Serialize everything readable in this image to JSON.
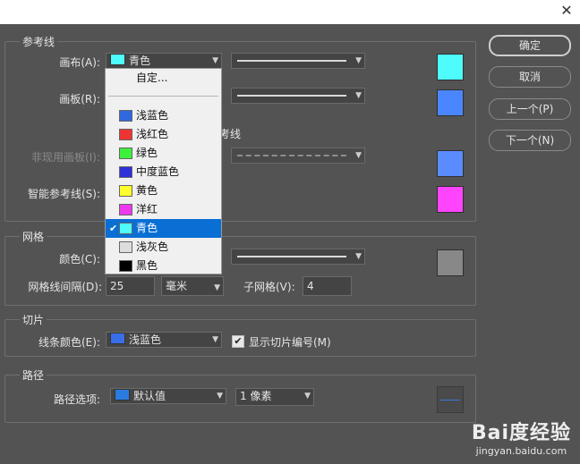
{
  "titlebar": {
    "close_glyph": "✕"
  },
  "guides": {
    "title": "参考线",
    "canvas_label": "画布(A):",
    "canvas_value": "青色",
    "canvas_color": "#4efcfc",
    "artboard_label": "画板(R):",
    "artboard_color": "#4a86ff",
    "partial_checkbox_text": "考线",
    "inactive_label": "非现用画板(I):",
    "inactive_color": "#5a8cff",
    "smart_label": "智能参考线(S):",
    "smart_color": "#ff44ff"
  },
  "grid": {
    "title": "网格",
    "color_label": "颜色(C):",
    "color_swatch": "#888888",
    "spacing_label": "网格线间隔(D):",
    "spacing_value": "25",
    "unit_value": "毫米",
    "subdivisions_label": "子网格(V):",
    "subdivisions_value": "4"
  },
  "slices": {
    "title": "切片",
    "line_color_label": "线条颜色(E):",
    "line_color_value": "浅蓝色",
    "line_color_swatch": "#3a6ee8",
    "show_numbers_label": "显示切片编号(M)",
    "show_numbers_checked": true,
    "check_glyph": "✔"
  },
  "path": {
    "title": "路径",
    "options_label": "路径选项:",
    "options_value": "默认值",
    "options_swatch": "#2a7be0",
    "width_value": "1 像素"
  },
  "buttons": {
    "ok": "确定",
    "cancel": "取消",
    "prev": "上一个(P)",
    "next": "下一个(N)"
  },
  "dropdown": {
    "custom_label": "自定...",
    "items": [
      {
        "label": "浅蓝色",
        "color": "#2f68e0"
      },
      {
        "label": "浅红色",
        "color": "#ee3333"
      },
      {
        "label": "绿色",
        "color": "#3ef03e"
      },
      {
        "label": "中度蓝色",
        "color": "#3030d8"
      },
      {
        "label": "黄色",
        "color": "#ffff2e"
      },
      {
        "label": "洋红",
        "color": "#ee38ee"
      },
      {
        "label": "青色",
        "color": "#4efcfc",
        "selected": true
      },
      {
        "label": "浅灰色",
        "color": "#dddddd"
      },
      {
        "label": "黑色",
        "color": "#000000"
      }
    ],
    "check_glyph": "✔"
  },
  "watermark": {
    "brand": "Bai度经验",
    "url": "jingyan.baidu.com"
  }
}
